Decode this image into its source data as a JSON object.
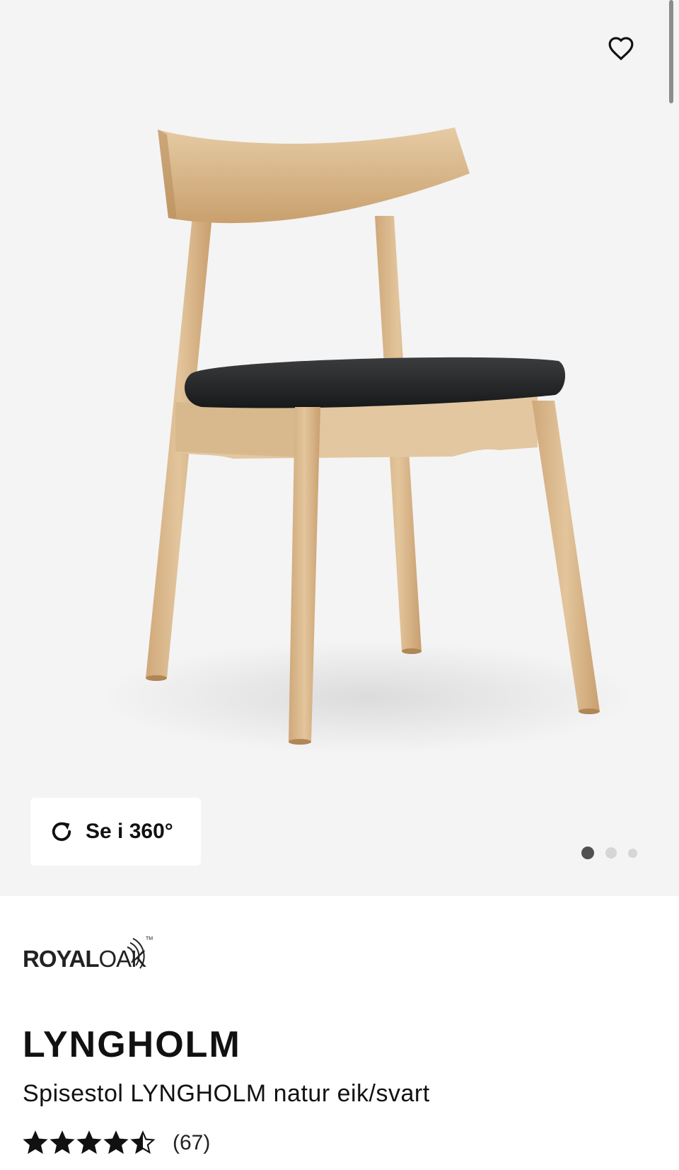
{
  "product": {
    "brand_logo_text": "ROYALOAK",
    "brand_bold": "ROYAL",
    "brand_light": "OAK",
    "brand_trademark": "TM",
    "name": "LYNGHOLM",
    "subtitle": "Spisestol LYNGHOLM natur eik/svart",
    "rating_value": 4.5,
    "rating_max": 5,
    "review_count": "(67)"
  },
  "gallery": {
    "view_360_label": "Se i 360°",
    "image_count": 3,
    "active_index": 0,
    "background_color": "#f4f4f4"
  },
  "icons": {
    "favorite": "heart-outline-icon",
    "rotate": "rotate-360-icon",
    "star": "star-icon"
  },
  "colors": {
    "wood": "#d9b98e",
    "seat": "#222426",
    "dot_active": "#505050",
    "dot_inactive": "#d6d6d6"
  }
}
